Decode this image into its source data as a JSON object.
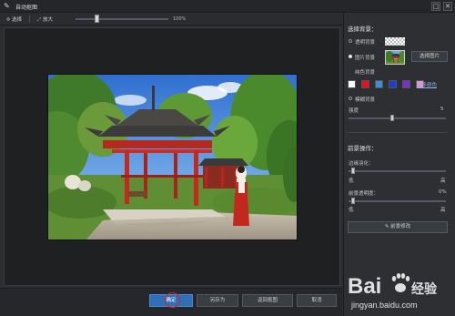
{
  "window": {
    "title": "自动抠图",
    "minimize_glyph": "□",
    "close_glyph": "✕"
  },
  "toolbar": {
    "select_label": "选择",
    "zoom_in_label": "放大",
    "zoom_value": "100%",
    "zoom_level": 0.22
  },
  "bottom": {
    "confirm_label": "确定",
    "save_as_label": "另存为",
    "back_label": "返回抠图",
    "cancel_label": "取消"
  },
  "panel": {
    "bg_heading": "选择背景：",
    "transparent_label": "透明背景",
    "image_bg_label": "图片背景",
    "choose_image_label": "选择图片",
    "solid_bg_label": "纯色背景",
    "more_colors_label": "更多颜色",
    "blur_bg_label": "模糊背景",
    "blur_amount_label": "强度",
    "blur_amount_value": "5",
    "blur_amount_level": 0.45,
    "fg_heading": "前景操作：",
    "edge_blur_label": "边缘羽化：",
    "edge_low": "低",
    "edge_high": "高",
    "edge_level": 0.03,
    "fg_opacity_label": "前景透明度：",
    "fg_opacity_value": "0%",
    "fg_low": "低",
    "fg_high": "高",
    "fg_opacity_level": 0.03,
    "fg_edit_label": "前景修改",
    "selected_bg": "image"
  },
  "swatches": [
    "#ffffff",
    "#e8101a",
    "#3a8fd8",
    "#1f3bd6",
    "#7a2fd0",
    "#ec8fd0"
  ],
  "watermark": {
    "brand_text": "Bai",
    "brand_suffix": "经验",
    "url": "jingyan.baidu.com"
  },
  "accent_color": "#2f6fb8",
  "highlight_color": "#e02020"
}
